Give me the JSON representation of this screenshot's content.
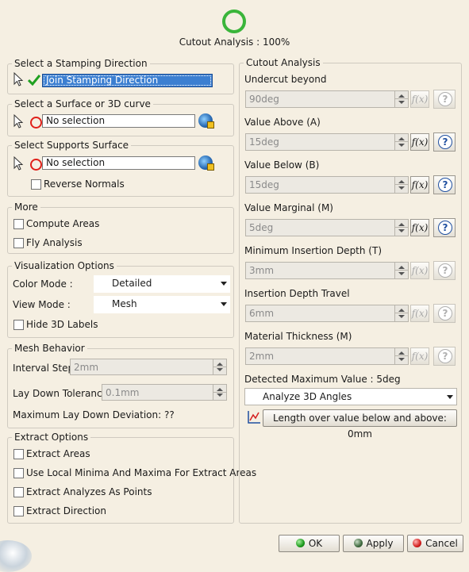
{
  "header": {
    "title": "Cutout Analysis : 100%",
    "progress_percent": 100
  },
  "stamping": {
    "legend": "Select a Stamping Direction",
    "value": "Join Stamping Direction"
  },
  "surface": {
    "legend": "Select a Surface or 3D curve",
    "value": "No selection"
  },
  "supports": {
    "legend": "Select Supports Surface",
    "value": "No selection",
    "reverse_normals_label": "Reverse Normals"
  },
  "more": {
    "legend": "More",
    "compute_areas_label": "Compute Areas",
    "fly_analysis_label": "Fly Analysis"
  },
  "visualization": {
    "legend": "Visualization Options",
    "color_mode_label": "Color Mode :",
    "color_mode_value": "Detailed",
    "view_mode_label": "View Mode :",
    "view_mode_value": "Mesh",
    "hide_3d_labels_label": "Hide 3D Labels"
  },
  "mesh": {
    "legend": "Mesh Behavior",
    "interval_step_label": "Interval Step",
    "interval_step_value": "2mm",
    "lay_down_tolerance_label": "Lay Down Tolerance",
    "lay_down_tolerance_value": "0.1mm",
    "max_lay_down_deviation": "Maximum Lay Down Deviation: ??"
  },
  "extract": {
    "legend": "Extract Options",
    "extract_areas_label": "Extract Areas",
    "local_minima_label": "Use Local Minima And Maxima For Extract Areas",
    "analyzes_as_points_label": "Extract Analyzes As Points",
    "extract_direction_label": "Extract Direction"
  },
  "cutout": {
    "legend": "Cutout Analysis",
    "undercut_label": "Undercut beyond",
    "undercut_value": "90deg",
    "value_above_label": "Value Above (A)",
    "value_above_value": "15deg",
    "value_below_label": "Value Below (B)",
    "value_below_value": "15deg",
    "value_marginal_label": "Value Marginal (M)",
    "value_marginal_value": "5deg",
    "min_insertion_label": "Minimum Insertion Depth (T)",
    "min_insertion_value": "3mm",
    "insertion_travel_label": "Insertion Depth Travel",
    "insertion_travel_value": "6mm",
    "material_thickness_label": "Material Thickness (M)",
    "material_thickness_value": "2mm",
    "detected_max": "Detected Maximum Value : 5deg",
    "analyze_mode_value": "Analyze 3D Angles",
    "length_button_label": "Length over value below and above: 0mm"
  },
  "footer": {
    "ok_label": "OK",
    "apply_label": "Apply",
    "cancel_label": "Cancel"
  },
  "icons": {
    "fx": "f(x)",
    "help": "?"
  },
  "colors": {
    "accent_blue": "#3c7fd1",
    "check_green": "#1fa01f",
    "status_red": "#e0201a",
    "background": "#f5efe2"
  }
}
